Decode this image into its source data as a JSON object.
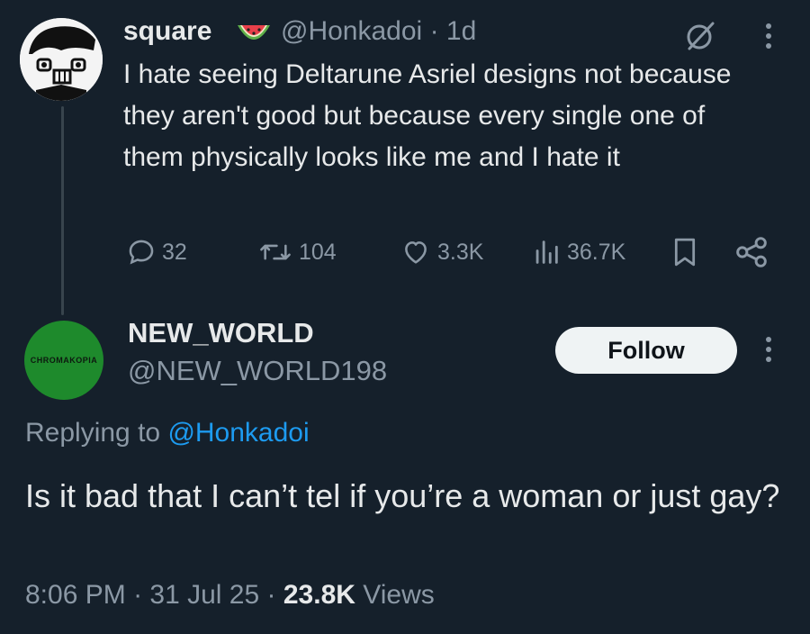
{
  "tweet": {
    "author_name": "square",
    "author_emoji": "watermelon-emoji",
    "handle": "@Honkadoi",
    "separator": "·",
    "time_ago": "1d",
    "text": "I hate seeing Deltarune Asriel designs not because they aren't good but because every single one of them physically looks like me and I hate it",
    "replies": "32",
    "retweets": "104",
    "likes": "3.3K",
    "views": "36.7K"
  },
  "reply": {
    "author_name": "NEW_WORLD",
    "handle": "@NEW_WORLD198",
    "avatar_text": "CHROMAKOPIA",
    "follow_label": "Follow",
    "replying_prefix": "Replying to",
    "replying_handle": "@Honkadoi",
    "text": "Is it bad that I can’t tel if you’re a woman or just gay?",
    "time": "8:06 PM",
    "date": "31 Jul 25",
    "sep": "·",
    "views_count": "23.8K",
    "views_label": "Views"
  },
  "colors": {
    "background": "#15202b",
    "text": "#e7e9ea",
    "muted": "#8b98a5",
    "accent": "#1d9bf0"
  }
}
